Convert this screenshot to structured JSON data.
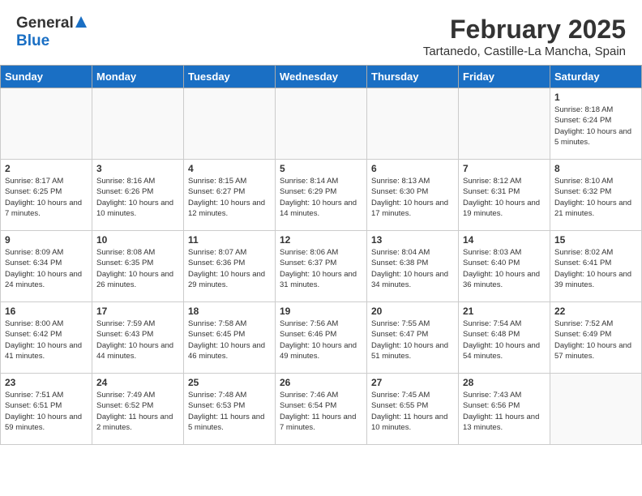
{
  "header": {
    "logo_general": "General",
    "logo_blue": "Blue",
    "month_year": "February 2025",
    "location": "Tartanedo, Castille-La Mancha, Spain"
  },
  "days_of_week": [
    "Sunday",
    "Monday",
    "Tuesday",
    "Wednesday",
    "Thursday",
    "Friday",
    "Saturday"
  ],
  "weeks": [
    [
      {
        "day": "",
        "text": ""
      },
      {
        "day": "",
        "text": ""
      },
      {
        "day": "",
        "text": ""
      },
      {
        "day": "",
        "text": ""
      },
      {
        "day": "",
        "text": ""
      },
      {
        "day": "",
        "text": ""
      },
      {
        "day": "1",
        "text": "Sunrise: 8:18 AM\nSunset: 6:24 PM\nDaylight: 10 hours and 5 minutes."
      }
    ],
    [
      {
        "day": "2",
        "text": "Sunrise: 8:17 AM\nSunset: 6:25 PM\nDaylight: 10 hours and 7 minutes."
      },
      {
        "day": "3",
        "text": "Sunrise: 8:16 AM\nSunset: 6:26 PM\nDaylight: 10 hours and 10 minutes."
      },
      {
        "day": "4",
        "text": "Sunrise: 8:15 AM\nSunset: 6:27 PM\nDaylight: 10 hours and 12 minutes."
      },
      {
        "day": "5",
        "text": "Sunrise: 8:14 AM\nSunset: 6:29 PM\nDaylight: 10 hours and 14 minutes."
      },
      {
        "day": "6",
        "text": "Sunrise: 8:13 AM\nSunset: 6:30 PM\nDaylight: 10 hours and 17 minutes."
      },
      {
        "day": "7",
        "text": "Sunrise: 8:12 AM\nSunset: 6:31 PM\nDaylight: 10 hours and 19 minutes."
      },
      {
        "day": "8",
        "text": "Sunrise: 8:10 AM\nSunset: 6:32 PM\nDaylight: 10 hours and 21 minutes."
      }
    ],
    [
      {
        "day": "9",
        "text": "Sunrise: 8:09 AM\nSunset: 6:34 PM\nDaylight: 10 hours and 24 minutes."
      },
      {
        "day": "10",
        "text": "Sunrise: 8:08 AM\nSunset: 6:35 PM\nDaylight: 10 hours and 26 minutes."
      },
      {
        "day": "11",
        "text": "Sunrise: 8:07 AM\nSunset: 6:36 PM\nDaylight: 10 hours and 29 minutes."
      },
      {
        "day": "12",
        "text": "Sunrise: 8:06 AM\nSunset: 6:37 PM\nDaylight: 10 hours and 31 minutes."
      },
      {
        "day": "13",
        "text": "Sunrise: 8:04 AM\nSunset: 6:38 PM\nDaylight: 10 hours and 34 minutes."
      },
      {
        "day": "14",
        "text": "Sunrise: 8:03 AM\nSunset: 6:40 PM\nDaylight: 10 hours and 36 minutes."
      },
      {
        "day": "15",
        "text": "Sunrise: 8:02 AM\nSunset: 6:41 PM\nDaylight: 10 hours and 39 minutes."
      }
    ],
    [
      {
        "day": "16",
        "text": "Sunrise: 8:00 AM\nSunset: 6:42 PM\nDaylight: 10 hours and 41 minutes."
      },
      {
        "day": "17",
        "text": "Sunrise: 7:59 AM\nSunset: 6:43 PM\nDaylight: 10 hours and 44 minutes."
      },
      {
        "day": "18",
        "text": "Sunrise: 7:58 AM\nSunset: 6:45 PM\nDaylight: 10 hours and 46 minutes."
      },
      {
        "day": "19",
        "text": "Sunrise: 7:56 AM\nSunset: 6:46 PM\nDaylight: 10 hours and 49 minutes."
      },
      {
        "day": "20",
        "text": "Sunrise: 7:55 AM\nSunset: 6:47 PM\nDaylight: 10 hours and 51 minutes."
      },
      {
        "day": "21",
        "text": "Sunrise: 7:54 AM\nSunset: 6:48 PM\nDaylight: 10 hours and 54 minutes."
      },
      {
        "day": "22",
        "text": "Sunrise: 7:52 AM\nSunset: 6:49 PM\nDaylight: 10 hours and 57 minutes."
      }
    ],
    [
      {
        "day": "23",
        "text": "Sunrise: 7:51 AM\nSunset: 6:51 PM\nDaylight: 10 hours and 59 minutes."
      },
      {
        "day": "24",
        "text": "Sunrise: 7:49 AM\nSunset: 6:52 PM\nDaylight: 11 hours and 2 minutes."
      },
      {
        "day": "25",
        "text": "Sunrise: 7:48 AM\nSunset: 6:53 PM\nDaylight: 11 hours and 5 minutes."
      },
      {
        "day": "26",
        "text": "Sunrise: 7:46 AM\nSunset: 6:54 PM\nDaylight: 11 hours and 7 minutes."
      },
      {
        "day": "27",
        "text": "Sunrise: 7:45 AM\nSunset: 6:55 PM\nDaylight: 11 hours and 10 minutes."
      },
      {
        "day": "28",
        "text": "Sunrise: 7:43 AM\nSunset: 6:56 PM\nDaylight: 11 hours and 13 minutes."
      },
      {
        "day": "",
        "text": ""
      }
    ]
  ]
}
